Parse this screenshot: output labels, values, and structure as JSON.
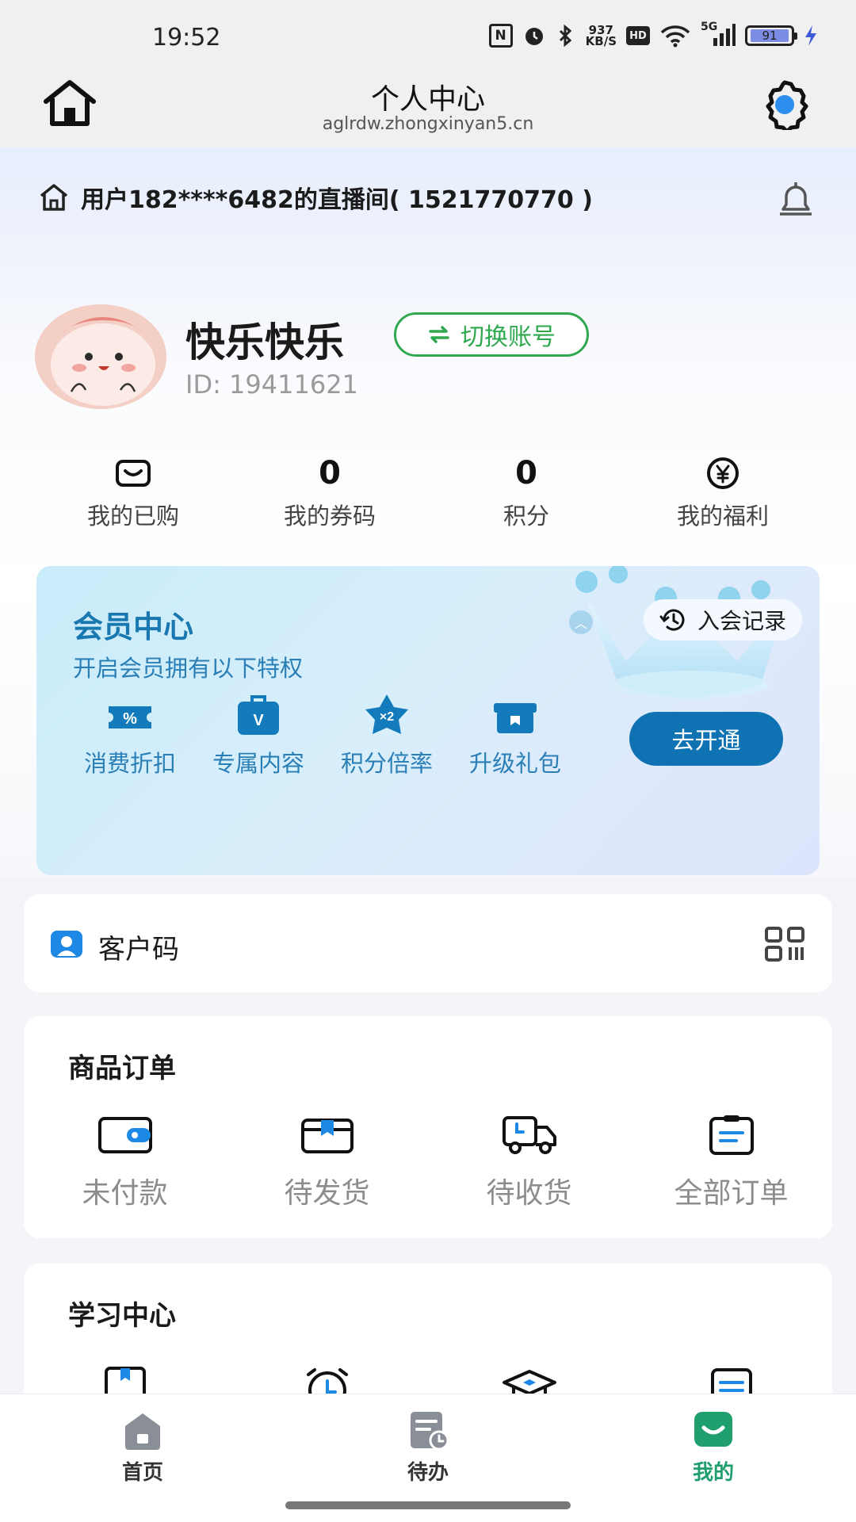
{
  "status_bar": {
    "time": "19:52",
    "net_speed_value": "937",
    "net_speed_unit": "KB/S",
    "hd_label": "HD",
    "signal_label": "5G",
    "battery_level": "91"
  },
  "title_bar": {
    "title": "个人中心",
    "url": "aglrdw.zhongxinyan5.cn"
  },
  "live_bar": {
    "text": "用户182****6482的直播间( 1521770770 )"
  },
  "profile": {
    "name": "快乐快乐",
    "switch_label": "切换账号",
    "id_text": "ID: 19411621"
  },
  "stats": [
    {
      "label": "我的已购",
      "icon": "bag-icon"
    },
    {
      "label": "我的券码",
      "value": "0"
    },
    {
      "label": "积分",
      "value": "0"
    },
    {
      "label": "我的福利",
      "icon": "yuan-coin-icon"
    }
  ],
  "vip": {
    "title": "会员中心",
    "subtitle": "开启会员拥有以下特权",
    "record_label": "入会记录",
    "open_label": "去开通",
    "perks": [
      {
        "label": "消费折扣",
        "icon": "discount-icon",
        "glyph": "%"
      },
      {
        "label": "专属内容",
        "icon": "vip-content-icon",
        "glyph": "V"
      },
      {
        "label": "积分倍率",
        "icon": "points-multiplier-icon",
        "glyph": "×2"
      },
      {
        "label": "升级礼包",
        "icon": "gift-icon",
        "glyph": ""
      }
    ]
  },
  "customer_code": {
    "title": "客户码"
  },
  "orders": {
    "title": "商品订单",
    "items": [
      {
        "label": "未付款",
        "icon": "wallet-icon"
      },
      {
        "label": "待发货",
        "icon": "box-icon"
      },
      {
        "label": "待收货",
        "icon": "truck-icon"
      },
      {
        "label": "全部订单",
        "icon": "clipboard-icon"
      }
    ]
  },
  "study": {
    "title": "学习中心",
    "items": [
      {
        "icon": "bookmark-book-icon"
      },
      {
        "icon": "alarm-clock-icon"
      },
      {
        "icon": "graduation-cap-icon"
      },
      {
        "icon": "notes-icon"
      }
    ]
  },
  "bottom_nav": [
    {
      "label": "首页",
      "icon": "home-tab-icon"
    },
    {
      "label": "待办",
      "icon": "todo-tab-icon"
    },
    {
      "label": "我的",
      "icon": "mine-tab-icon",
      "active": true
    }
  ],
  "colors": {
    "accent_green": "#2fa84f",
    "vip_blue": "#0f73b3",
    "nav_active": "#1f9e6e",
    "icon_blue": "#1e88e5"
  }
}
